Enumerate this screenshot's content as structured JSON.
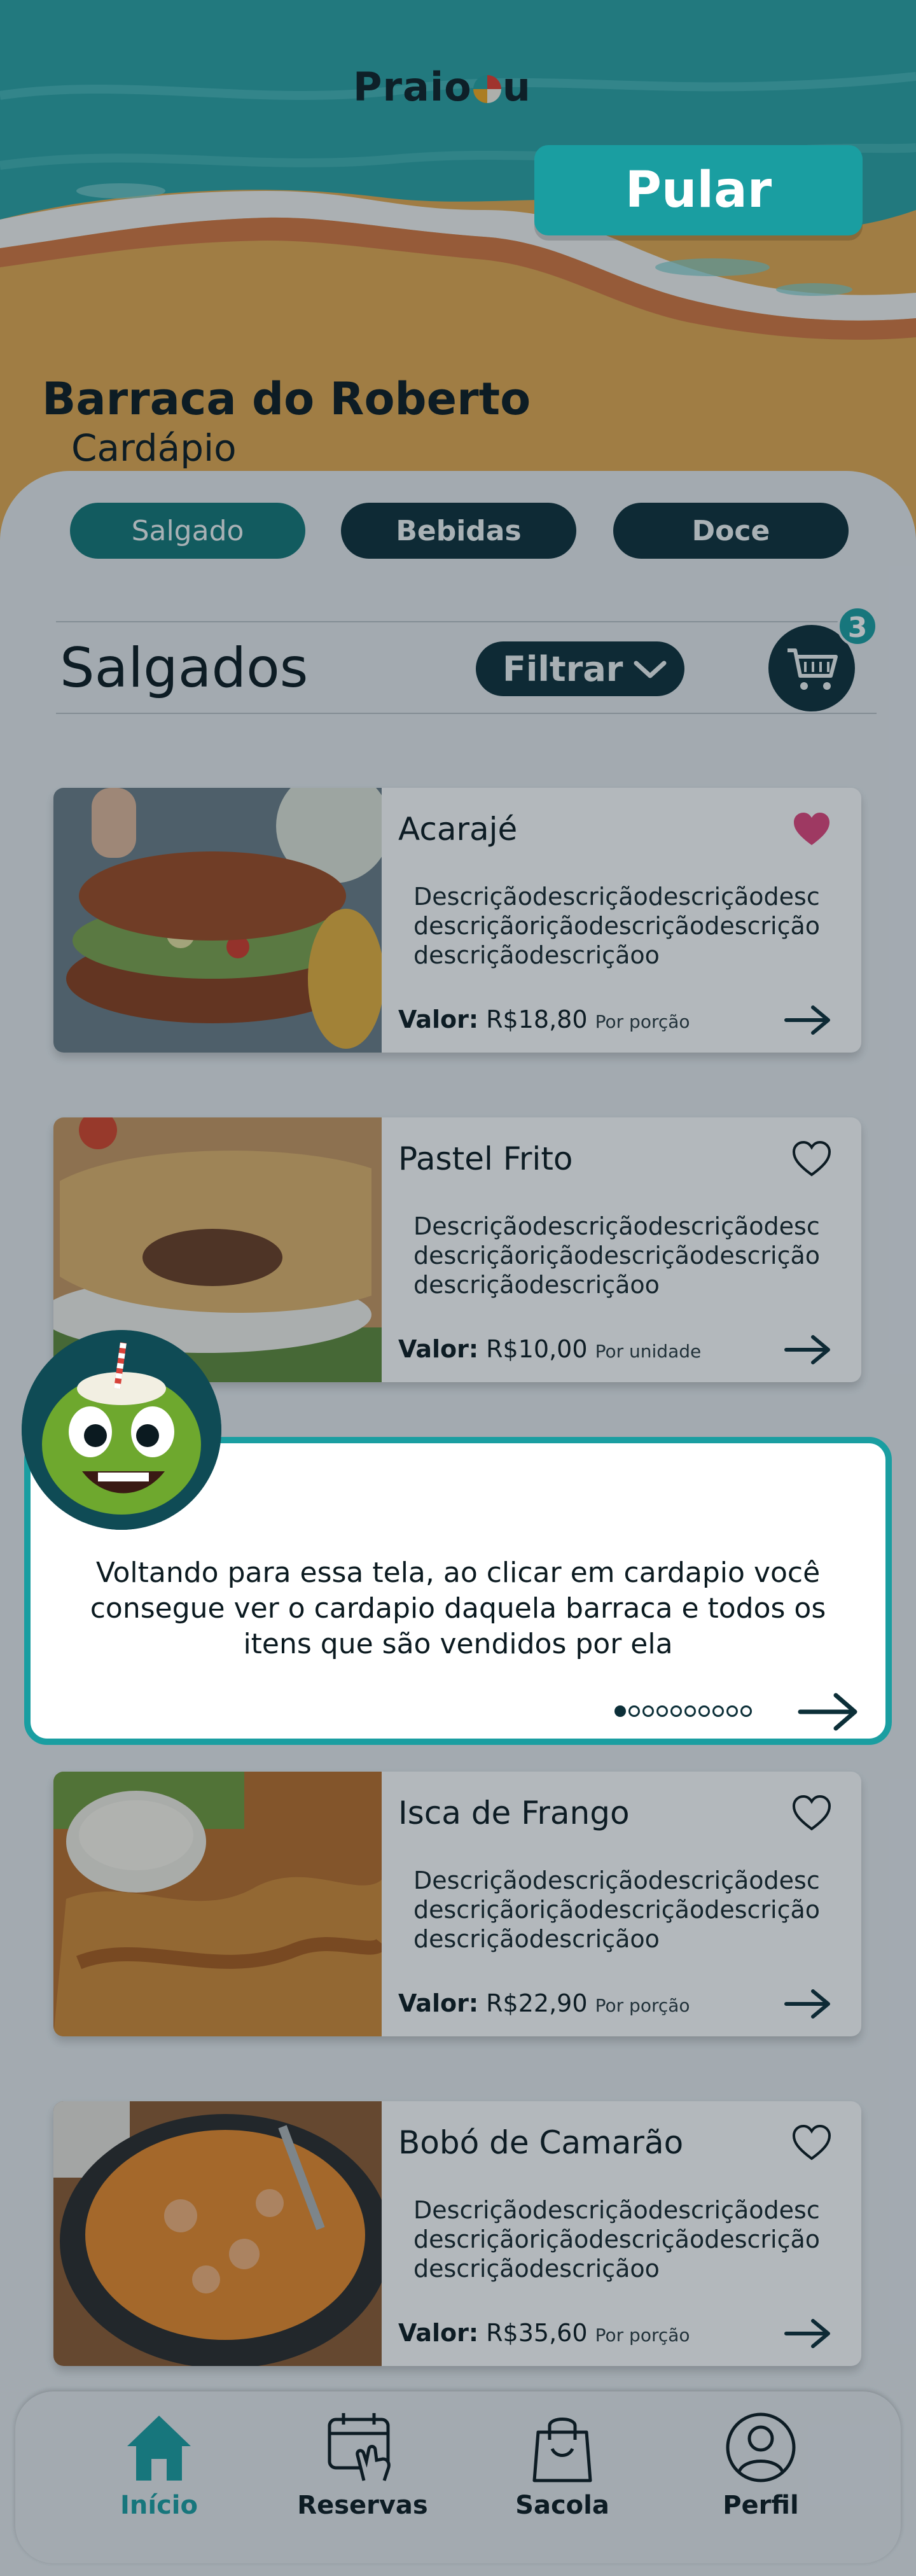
{
  "app": {
    "logo_text_left": "Praio",
    "logo_text_right": "u",
    "skip_label": "Pular"
  },
  "store": {
    "name": "Barraca do Roberto",
    "subtitle": "Cardápio"
  },
  "categories": [
    {
      "label": "Salgado",
      "active": true
    },
    {
      "label": "Bebidas",
      "active": false
    },
    {
      "label": "Doce",
      "active": false
    }
  ],
  "section": {
    "title": "Salgados",
    "filter_label": "Filtrar",
    "cart_count": "3"
  },
  "products": [
    {
      "name": "Acarajé",
      "description": "Descriçãodescriçãodescriçãodescdescriçãoriçãodescriçãodescriçãodescriçãodescriçãoo",
      "price_label": "Valor:",
      "price": "R$18,80",
      "unit": "Por porção",
      "favorite": true
    },
    {
      "name": "Pastel Frito",
      "description": "Descriçãodescriçãodescriçãodescdescriçãoriçãodescriçãodescriçãodescriçãodescriçãoo",
      "price_label": "Valor:",
      "price": "R$10,00",
      "unit": "Por unidade",
      "favorite": false
    },
    {
      "name": "Isca de Frango",
      "description": "Descriçãodescriçãodescriçãodescdescriçãoriçãodescriçãodescriçãodescriçãodescriçãoo",
      "price_label": "Valor:",
      "price": "R$22,90",
      "unit": "Por porção",
      "favorite": false
    },
    {
      "name": "Bobó de Camarão",
      "description": "Descriçãodescriçãodescriçãodescdescriçãoriçãodescriçãodescriçãodescriçãodescriçãoo",
      "price_label": "Valor:",
      "price": "R$35,60",
      "unit": "Por porção",
      "favorite": false
    }
  ],
  "tutorial": {
    "text": "Voltando para essa tela, ao clicar em cardapio você consegue ver o cardapio daquela barraca e todos os itens que são vendidos por ela",
    "step": 1,
    "total_steps": 10
  },
  "nav": [
    {
      "label": "Início",
      "icon": "home-icon",
      "active": true
    },
    {
      "label": "Reservas",
      "icon": "calendar-touch-icon",
      "active": false
    },
    {
      "label": "Sacola",
      "icon": "shopping-bag-icon",
      "active": false
    },
    {
      "label": "Perfil",
      "icon": "profile-icon",
      "active": false
    }
  ],
  "colors": {
    "teal": "#1a9ea1",
    "dark": "#0c2f38",
    "sand": "#e8ae4f",
    "sea": "#2aa3a3",
    "heart": "#e0457b"
  }
}
